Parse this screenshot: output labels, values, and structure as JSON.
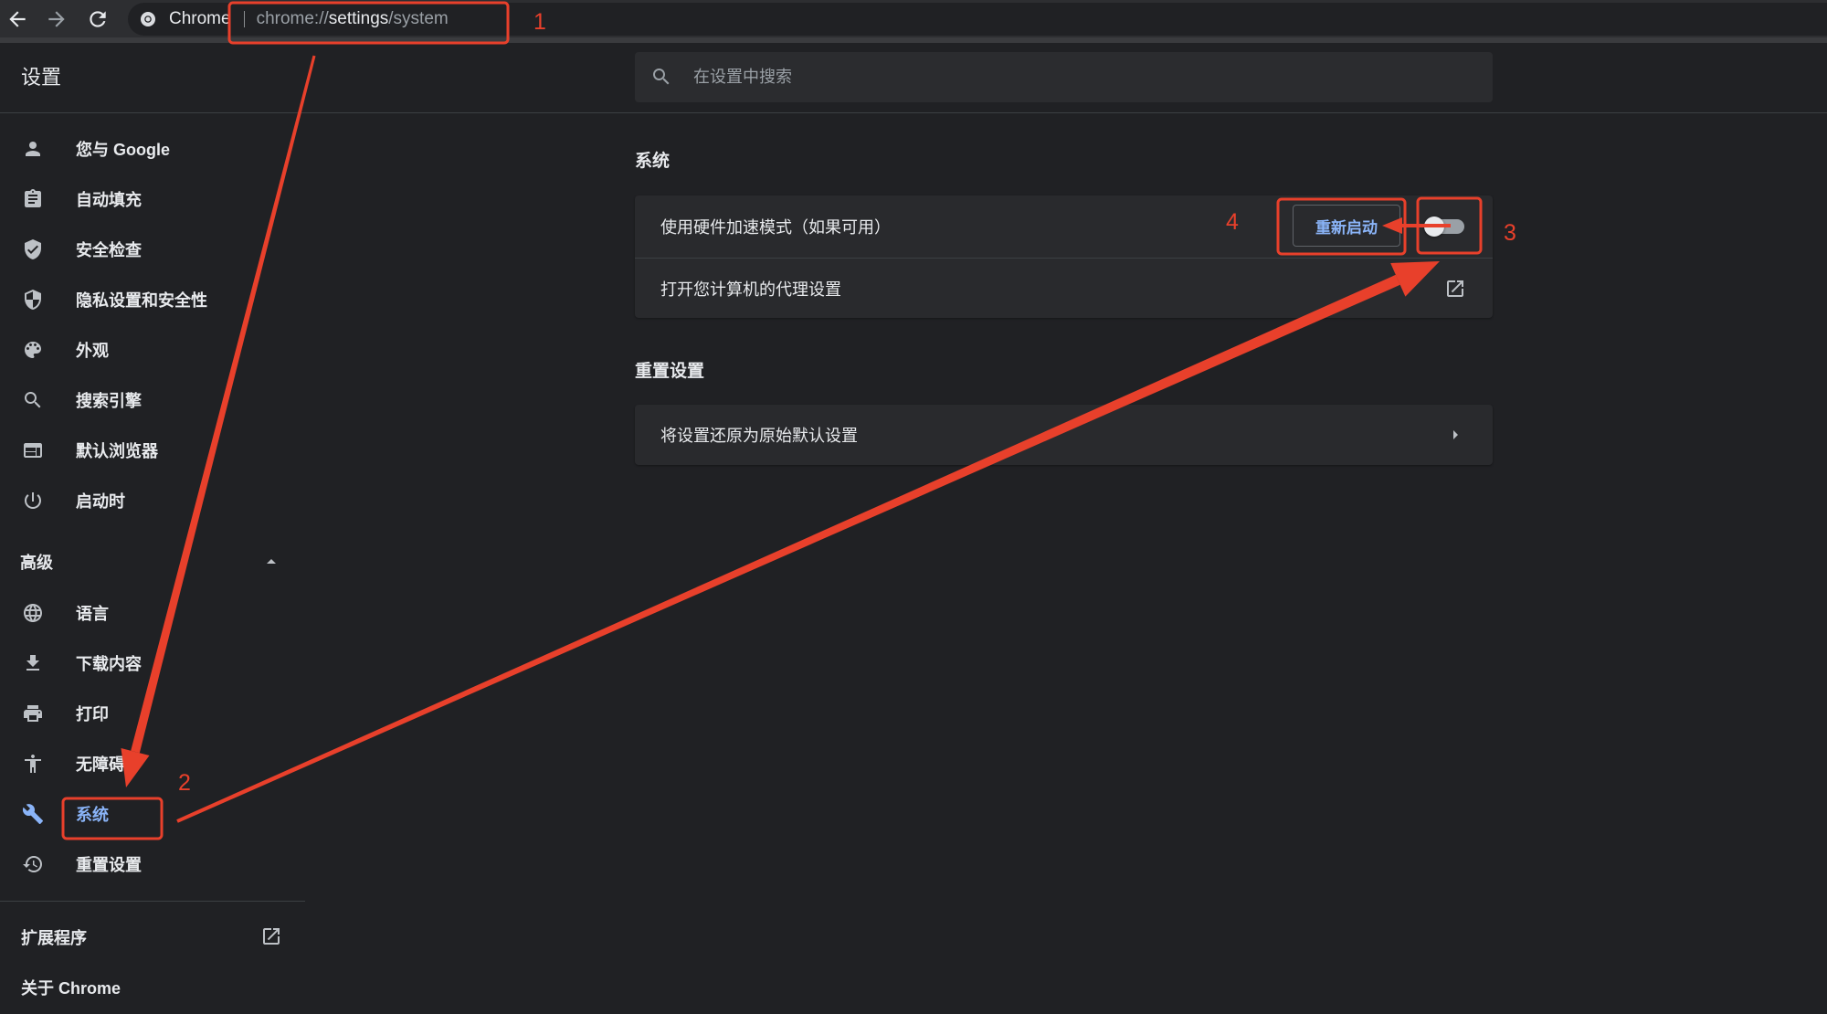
{
  "browser": {
    "site_label": "Chrome",
    "url_scheme": "chrome://",
    "url_host": "settings",
    "url_path": "/system",
    "icons": [
      "back-arrow-icon",
      "forward-arrow-icon",
      "reload-icon",
      "chrome-logo-icon"
    ]
  },
  "header": {
    "title": "设置",
    "search_placeholder": "在设置中搜索"
  },
  "sidebar": {
    "items": [
      {
        "label": "您与 Google",
        "icon": "person-icon"
      },
      {
        "label": "自动填充",
        "icon": "clipboard-icon"
      },
      {
        "label": "安全检查",
        "icon": "shield-check-icon"
      },
      {
        "label": "隐私设置和安全性",
        "icon": "shield-icon"
      },
      {
        "label": "外观",
        "icon": "palette-icon"
      },
      {
        "label": "搜索引擎",
        "icon": "search-icon"
      },
      {
        "label": "默认浏览器",
        "icon": "browser-icon"
      },
      {
        "label": "启动时",
        "icon": "power-icon"
      }
    ],
    "advanced": {
      "label": "高级",
      "expanded": true,
      "items": [
        {
          "label": "语言",
          "icon": "globe-icon"
        },
        {
          "label": "下载内容",
          "icon": "download-icon"
        },
        {
          "label": "打印",
          "icon": "printer-icon"
        },
        {
          "label": "无障碍",
          "icon": "accessibility-icon"
        },
        {
          "label": "系统",
          "icon": "wrench-icon",
          "selected": true
        },
        {
          "label": "重置设置",
          "icon": "restore-icon"
        }
      ]
    },
    "extensions_label": "扩展程序",
    "about_label": "关于 Chrome"
  },
  "main": {
    "system_section": {
      "title": "系统",
      "hardware_accel_label": "使用硬件加速模式（如果可用）",
      "relaunch_button": "重新启动",
      "hardware_accel_enabled": false,
      "proxy_label": "打开您计算机的代理设置"
    },
    "reset_section": {
      "title": "重置设置",
      "reset_label": "将设置还原为原始默认设置"
    }
  },
  "annotations": {
    "label_1": "1",
    "label_2": "2",
    "label_3": "3",
    "label_4": "4"
  },
  "colors": {
    "accent": "#8ab4f8",
    "annotation": "#e8402b",
    "background": "#202124",
    "card": "#292a2d"
  }
}
